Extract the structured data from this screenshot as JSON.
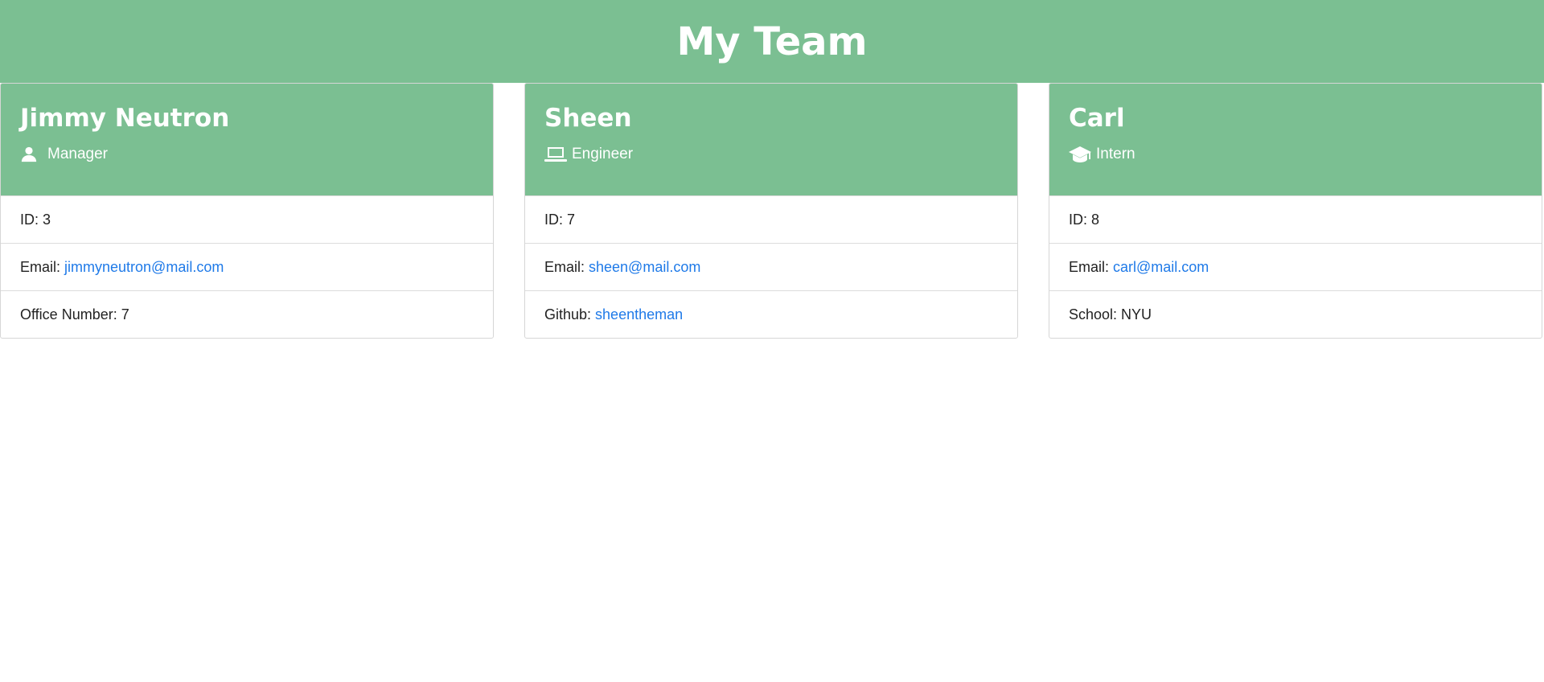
{
  "page_title": "My Team",
  "colors": {
    "header_bg": "#7bbf92",
    "link": "#1f7ae8"
  },
  "cards": [
    {
      "name": "Jimmy Neutron",
      "role": "Manager",
      "role_icon": "person-icon",
      "rows": [
        {
          "label": "ID: 3"
        },
        {
          "label": "Email:",
          "link": "jimmyneutron@mail.com"
        },
        {
          "label": "Office Number: 7"
        }
      ]
    },
    {
      "name": "Sheen",
      "role": "Engineer",
      "role_icon": "laptop-icon",
      "rows": [
        {
          "label": "ID: 7"
        },
        {
          "label": "Email:",
          "link": "sheen@mail.com"
        },
        {
          "label": "Github:",
          "link": "sheentheman"
        }
      ]
    },
    {
      "name": "Carl",
      "role": "Intern",
      "role_icon": "graduation-cap-icon",
      "rows": [
        {
          "label": "ID: 8"
        },
        {
          "label": "Email:",
          "link": "carl@mail.com"
        },
        {
          "label": "School: NYU"
        }
      ]
    }
  ]
}
